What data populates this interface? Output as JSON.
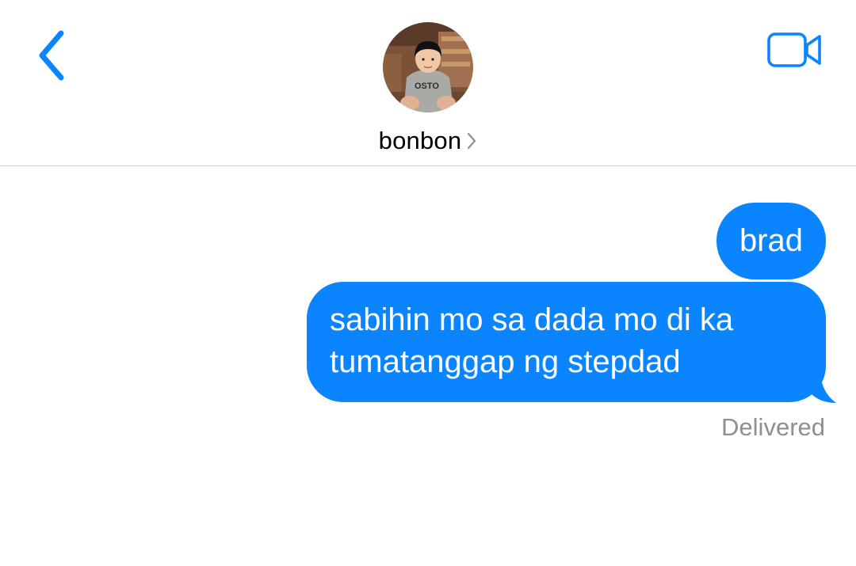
{
  "header": {
    "back_icon": "chevron-left-icon",
    "video_icon": "video-camera-icon",
    "contact_name": "bonbon",
    "contact_chevron_icon": "chevron-right-icon",
    "avatar_description_icon": "contact-avatar-photo"
  },
  "messages": [
    {
      "direction": "outgoing",
      "text": "brad"
    },
    {
      "direction": "outgoing",
      "text": "sabihin mo sa dada mo di ka\ntumatanggap ng stepdad"
    }
  ],
  "status": "Delivered",
  "colors": {
    "accent": "#0a84ff",
    "bubble_text": "#ffffff",
    "status_text": "#8e8e93",
    "divider": "#cfcfd3"
  }
}
